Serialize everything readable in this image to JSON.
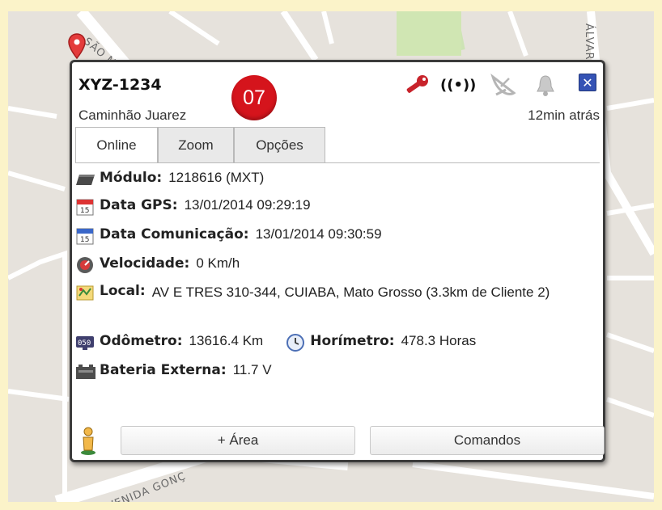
{
  "map": {
    "street_labels": [
      "SÃO MIGUEL",
      "ÁLVARES",
      "AVENIDA GONÇ"
    ]
  },
  "popup": {
    "plate": "XYZ-1234",
    "driver": "Caminhão Juarez",
    "number_badge": "07",
    "last_update": "12min atrás",
    "signal_glyph": "((•))",
    "close_glyph": "✕",
    "tabs": [
      {
        "label": "Online",
        "active": true
      },
      {
        "label": "Zoom",
        "active": false
      },
      {
        "label": "Opções",
        "active": false
      }
    ],
    "details": {
      "modulo": {
        "label": "Módulo:",
        "value": "1218616 (MXT)"
      },
      "data_gps": {
        "label": "Data GPS:",
        "value": "13/01/2014 09:29:19"
      },
      "data_comunicacao": {
        "label": "Data Comunicação:",
        "value": "13/01/2014 09:30:59"
      },
      "velocidade": {
        "label": "Velocidade:",
        "value": "0 Km/h"
      },
      "local": {
        "label": "Local:",
        "value": "AV E TRES 310-344, CUIABA, Mato Grosso (3.3km de Cliente 2)"
      },
      "odometro": {
        "label": "Odômetro:",
        "value": "13616.4 Km"
      },
      "horimetro": {
        "label": "Horímetro:",
        "value": "478.3 Horas"
      },
      "bateria": {
        "label": "Bateria Externa:",
        "value": "11.7 V"
      }
    },
    "buttons": {
      "area": "+ Área",
      "comandos": "Comandos"
    },
    "icons": [
      "key-icon",
      "signal-icon",
      "satellite-dish-icon",
      "bell-icon",
      "close-icon",
      "module-icon",
      "calendar-icon",
      "speedometer-icon",
      "map-icon",
      "odometer-icon",
      "clock-icon",
      "battery-icon",
      "person-icon"
    ],
    "colors": {
      "badge": "#d5141c",
      "close_button": "#3553b5",
      "frame": "#3b3b3b"
    }
  }
}
